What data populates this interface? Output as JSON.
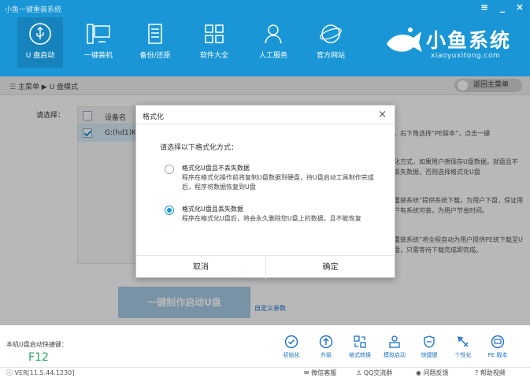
{
  "window": {
    "title": "小鱼一键重装系统",
    "menu_glyph": "≡",
    "minimize_glyph": "_",
    "close_glyph": "×"
  },
  "nav": [
    {
      "label": "U 盘启动",
      "icon": "usb-icon"
    },
    {
      "label": "一键装机",
      "icon": "computer-icon"
    },
    {
      "label": "备份/还原",
      "icon": "document-icon"
    },
    {
      "label": "软件大全",
      "icon": "grid-icon"
    },
    {
      "label": "人工服务",
      "icon": "person-icon"
    },
    {
      "label": "官方网站",
      "icon": "globe-icon"
    }
  ],
  "logo": {
    "main": "小鱼系统",
    "sub": "xiaoyuxitong.com"
  },
  "breadcrumb": {
    "text": "主菜单 ▶ U 盘模式",
    "back_label": "返回主菜单"
  },
  "main": {
    "prompt": "请选择：",
    "table": {
      "header": "设备名",
      "row": "G:(hd1)Ki"
    },
    "tips": [
      "，右下角选择“PE版本”，点击一键",
      "化方式，如果用户想保存U盘数据，就盘且不丢失数据，否则选择格式化U盘",
      "重装系统”提供系统下载，为用户下盘，保证用户有系统可装，为用户节省时间。",
      "重装系统”将全程自动为用户提供PE统下载至U盘，只需等待下载完成即完成。"
    ],
    "make_button": "一键制作启动U盘",
    "custom_link": "自定义参数"
  },
  "dialog": {
    "title": "格式化",
    "close_glyph": "×",
    "question": "请选择以下格式化方式：",
    "options": [
      {
        "title": "格式化U盘且不丢失数据",
        "desc": "程序在格式化操作前将复制U盘数据到硬盘，待U盘启动工具制作完成后，程序将数据恢复到U盘",
        "selected": false
      },
      {
        "title": "格式化U盘且丢失数据",
        "desc": "程序在格式化U盘后，将会永久删除您U盘上的数据，且不能恢复",
        "selected": true
      }
    ],
    "cancel": "取消",
    "ok": "确定"
  },
  "hotkey": {
    "label": "本机U盘启动快捷键：",
    "value": "F12"
  },
  "tools": [
    {
      "label": "初始化",
      "icon": "check-circle-icon"
    },
    {
      "label": "升级",
      "icon": "upgrade-icon"
    },
    {
      "label": "格式转换",
      "icon": "convert-icon"
    },
    {
      "label": "模拟启动",
      "icon": "simulate-icon"
    },
    {
      "label": "快捷键",
      "icon": "shield-icon"
    },
    {
      "label": "个性化",
      "icon": "brush-icon"
    },
    {
      "label": "PE 版本",
      "icon": "pe-icon"
    }
  ],
  "status": {
    "version": "VER[11.5.44.1230]",
    "links": [
      "微信客服",
      "QQ交流群",
      "问题反馈",
      "帮助视频"
    ]
  },
  "colors": {
    "accent": "#1a96d6",
    "hotkey": "#2aa36a",
    "link": "#1a6fc9"
  }
}
